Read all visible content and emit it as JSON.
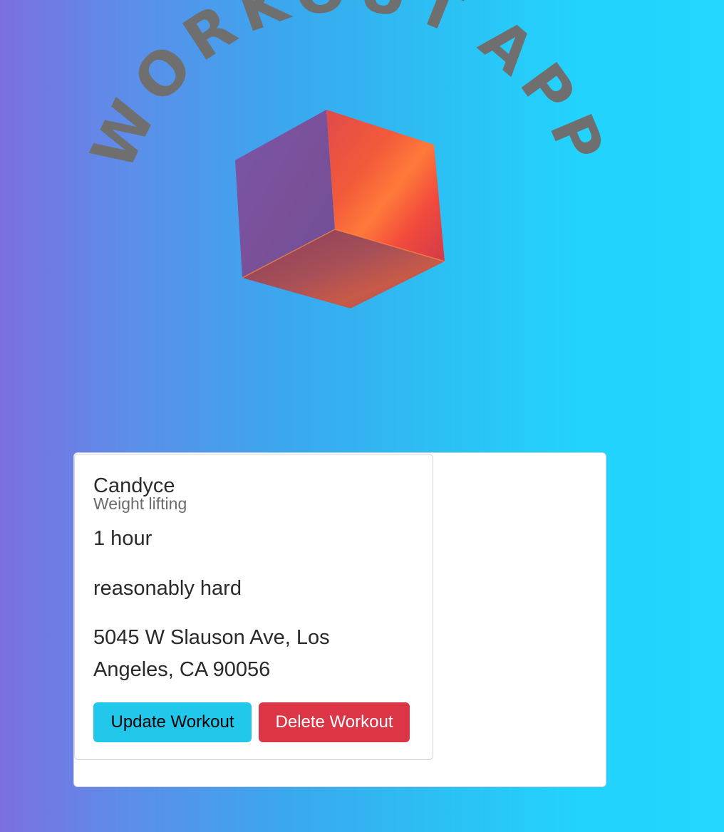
{
  "header": {
    "logo_text_left": "WORKOUT",
    "logo_text_right": "APP"
  },
  "workout": {
    "name": "Candyce",
    "type": "Weight lifting",
    "duration": "1 hour",
    "intensity": "reasonably hard",
    "address": "5045 W Slauson Ave, Los Angeles, CA 90056",
    "update_label": "Update Workout",
    "delete_label": "Delete Workout"
  },
  "colors": {
    "text_arc": "#6f6f6f",
    "update_button": "#22c7ec",
    "delete_button": "#dc3545",
    "background_start": "#7b6fe0",
    "background_end": "#22d6fd"
  }
}
